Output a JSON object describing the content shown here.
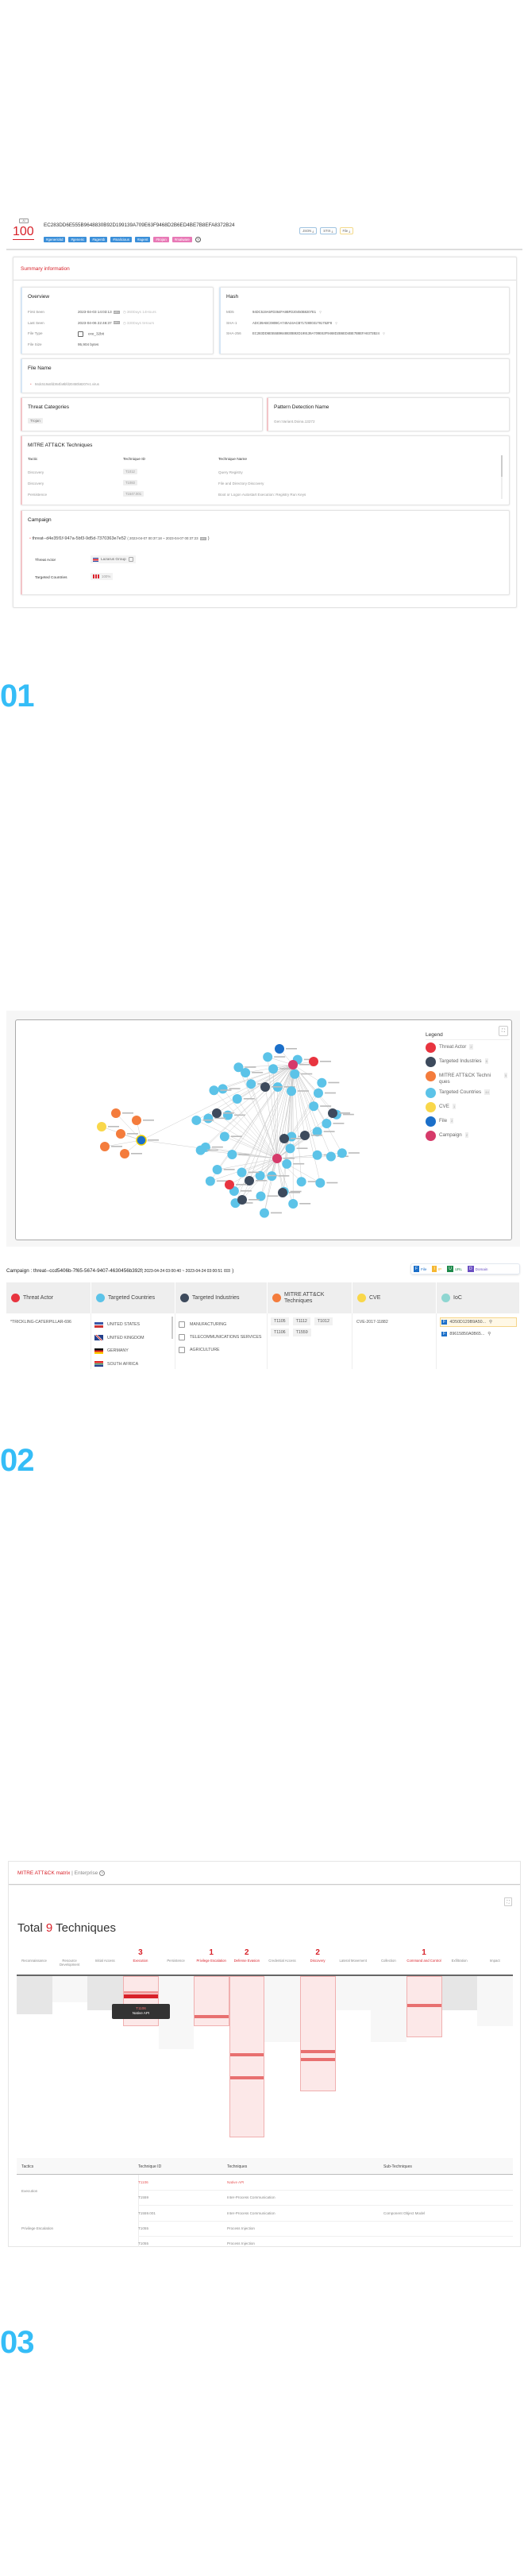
{
  "sections": {
    "s1": "01",
    "s2": "02",
    "s3": "03"
  },
  "header": {
    "ai_badge": "AI",
    "score": "100",
    "hash": "EC283DD6E555B9648830B92D199139A709E63F9468D2B6ED4BE7B8EFA8372B24",
    "downloads": [
      {
        "label": "JSON ⤓",
        "color": "#9fc3e0"
      },
      {
        "label": "STIX ⤓",
        "color": "#9fc3e0"
      },
      {
        "label": "File ⤓",
        "color": "#f3d98a"
      }
    ],
    "tags": [
      {
        "label": "#generickd",
        "color": "#3b8fd9"
      },
      {
        "label": "#generic",
        "color": "#3b8fd9"
      },
      {
        "label": "#agentb",
        "color": "#3b8fd9"
      },
      {
        "label": "#malicious",
        "color": "#3b8fd9"
      },
      {
        "label": "#agent",
        "color": "#3b8fd9"
      },
      {
        "label": "#trojan",
        "color": "#e879b6"
      },
      {
        "label": "#malware",
        "color": "#e879b6"
      }
    ],
    "help_icon": "question-circle-icon"
  },
  "summary": {
    "title": "Summary information",
    "overview": {
      "title": "Overview",
      "rows": [
        {
          "label": "First Seen",
          "value": "2023-04-03 14:03:13",
          "badge": "UTC",
          "ago": "360Days 14Hours"
        },
        {
          "label": "Last Seen",
          "value": "2023-04-06 22:46:37",
          "badge": "UTC",
          "ago": "330Days 5Hours"
        },
        {
          "label": "File Type",
          "value": "exe_32bit"
        },
        {
          "label": "File Size",
          "value": "95,904 bytes"
        }
      ]
    },
    "hash": {
      "title": "Hash",
      "rows": [
        {
          "label": "MD5",
          "value": "94DC519A5FD364FA9BFD20450B8207E1"
        },
        {
          "label": "SHA-1",
          "value": "ADC39ABC0808CA740A24ACB717280031791752F8"
        },
        {
          "label": "SHA-256",
          "value": "EC283DD6E555B9648830B92D199139A709E63F9468D2B6ED4BE7B8EFA8372B24"
        }
      ]
    },
    "file_name": {
      "title": "File Name",
      "value": "94dc519a5fd364fa9bfd20450b8207e1.virus"
    },
    "threat_categories": {
      "title": "Threat Categories",
      "value": "Trojan"
    },
    "pattern": {
      "title": "Pattern Detection Name",
      "value": "Gen:Variant.Doina.13272"
    },
    "mitre": {
      "title": "MITRE ATT&CK Techniques",
      "columns": [
        "Tactic",
        "Technique ID",
        "Technique Name"
      ],
      "rows": [
        [
          "Discovery",
          "T1012",
          "Query Registry"
        ],
        [
          "Discovery",
          "T1083",
          "File and Directory Discovery"
        ],
        [
          "Persistence",
          "T1547.001",
          "Boot or Logon Autostart Execution: Registry Run Keys"
        ]
      ]
    },
    "campaign": {
      "title": "Campaign",
      "id": "threat--d4e35f1f-947a-5bf3-9d5d-7370363e7e52",
      "range_start": "( 2023-04-07 00:37:18 ~ 2023-04-07 00:37:23",
      "range_end": ")",
      "badge": "UTC",
      "threat_actor_label": "Threat Actor",
      "threat_actor": "Lazarus Group",
      "targeted_countries_label": "Targeted Countries",
      "targeted_country_pct": "100%"
    }
  },
  "graph": {
    "legend_title": "Legend",
    "legend": [
      {
        "label": "Threat Actor",
        "count": "2",
        "color": "#e8343f"
      },
      {
        "label": "Targeted Industries",
        "count": "8",
        "color": "#3d4a5c"
      },
      {
        "label": "MITRE ATT&CK Techni ques",
        "count": "5",
        "color": "#f47c3c"
      },
      {
        "label": "Targeted Countries",
        "count": "44",
        "color": "#5cc3e8"
      },
      {
        "label": "CVE",
        "count": "1",
        "color": "#f9d74a"
      },
      {
        "label": "File",
        "count": "2",
        "color": "#1b6fc9"
      },
      {
        "label": "Campaign",
        "count": "2",
        "color": "#d63a6a"
      }
    ]
  },
  "campaign2": {
    "title": "Campaign : threat--ccd5406b-7f65-5674-9407-4630456b392f",
    "range": "( 2023-04-24 03:00:40 ~ 2023-04-24 03:00:51",
    "range_end": ")",
    "badge": "UTC",
    "ioc_legend": [
      {
        "letter": "F",
        "label": "File",
        "color": "#1b6fc9"
      },
      {
        "letter": "I",
        "label": "IP",
        "color": "#f5b731"
      },
      {
        "letter": "U",
        "label": "URL",
        "color": "#1e8a4c"
      },
      {
        "letter": "D",
        "label": "Domain",
        "color": "#6a4fc2"
      }
    ],
    "columns": [
      {
        "label": "Threat Actor",
        "color": "#e8343f"
      },
      {
        "label": "Targeted Countries",
        "color": "#5cc3e8"
      },
      {
        "label": "Targeted Industries",
        "color": "#3d4a5c"
      },
      {
        "label": "MITRE ATT&CK Techniques",
        "color": "#f47c3c"
      },
      {
        "label": "CVE",
        "color": "#f9d74a"
      },
      {
        "label": "IoC",
        "color": "#8fd6d1"
      }
    ],
    "threat_actor": "*TRICKLING-CATERPILLAR-696",
    "countries": [
      "UNITED STATES",
      "UNITED KINGDOM",
      "GERMANY",
      "SOUTH AFRICA"
    ],
    "industries": [
      "MANUFACTURING",
      "TELECOMMUNICATIONS SERVICES",
      "AGRICULTURE"
    ],
    "techniques": [
      "T1105",
      "T1112",
      "T1012",
      "T1106",
      "T1559"
    ],
    "cve": "CVE-2017-11882",
    "iocs": [
      {
        "type": "F",
        "value": "4D50D129B9A50..."
      },
      {
        "type": "F",
        "value": "89615850A0B65..."
      }
    ]
  },
  "matrix": {
    "title": "MITRE ATT&CK matrix",
    "subtitle": "| Enterprise",
    "total_prefix": "Total",
    "total": "9",
    "total_suffix": "Techniques",
    "tactics": [
      {
        "name": "Reconnaissance",
        "count": ""
      },
      {
        "name": "Resource Development",
        "count": ""
      },
      {
        "name": "Initial Access",
        "count": ""
      },
      {
        "name": "Execution",
        "count": "3"
      },
      {
        "name": "Persistence",
        "count": ""
      },
      {
        "name": "Privilege Escalation",
        "count": "1"
      },
      {
        "name": "Defense Evasion",
        "count": "2"
      },
      {
        "name": "Credential Access",
        "count": ""
      },
      {
        "name": "Discovery",
        "count": "2"
      },
      {
        "name": "Lateral Movement",
        "count": ""
      },
      {
        "name": "Collection",
        "count": ""
      },
      {
        "name": "Command and Control",
        "count": "1"
      },
      {
        "name": "Exfiltration",
        "count": ""
      },
      {
        "name": "Impact",
        "count": ""
      }
    ],
    "tooltip": {
      "id": "T1106",
      "name": "Native API"
    },
    "table": {
      "columns": [
        "Tactics",
        "Technique ID",
        "Techniques",
        "Sub-Techniques"
      ],
      "rows": [
        {
          "tactic": "",
          "id": "T1106",
          "name": "Native API",
          "sub": "",
          "highlight": true
        },
        {
          "tactic": "Execution",
          "id": "T1559",
          "name": "Inter-Process Communication",
          "sub": ""
        },
        {
          "tactic": "",
          "id": "T1559.001",
          "name": "Inter-Process Communication",
          "sub": "Component Object Model"
        },
        {
          "tactic": "Privilege Escalation",
          "id": "T1055",
          "name": "Process Injection",
          "sub": ""
        },
        {
          "tactic": "",
          "id": "T1055",
          "name": "Process Injection",
          "sub": ""
        }
      ]
    }
  }
}
